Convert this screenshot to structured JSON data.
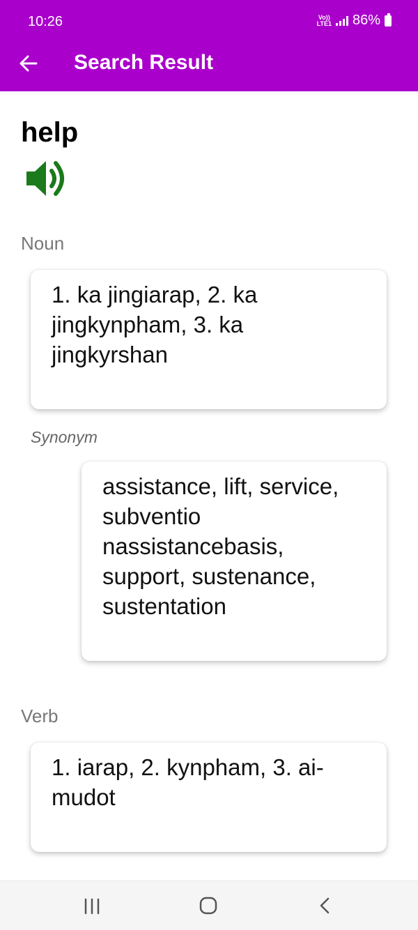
{
  "status": {
    "time": "10:26",
    "network": [
      "Vo))",
      "LTE1"
    ],
    "battery": "86%"
  },
  "appbar": {
    "title": "Search Result",
    "color": "#AA00CC"
  },
  "entry": {
    "word": "help",
    "noun_label": "Noun",
    "noun_meaning": "1. ka jingiarap, 2. ka jingkynpham, 3. ka jingkyrshan",
    "synonym_label": "Synonym",
    "synonyms": "assistance, lift, service, subventio nassistancebasis, support, sustenance, sustentation",
    "verb_label": "Verb",
    "verb_meaning": "1. iarap, 2. kynpham, 3. ai-mudot"
  },
  "icons": {
    "back": "arrow-left-icon",
    "speaker": "speaker-icon",
    "speaker_color": "#1B7A1B"
  }
}
